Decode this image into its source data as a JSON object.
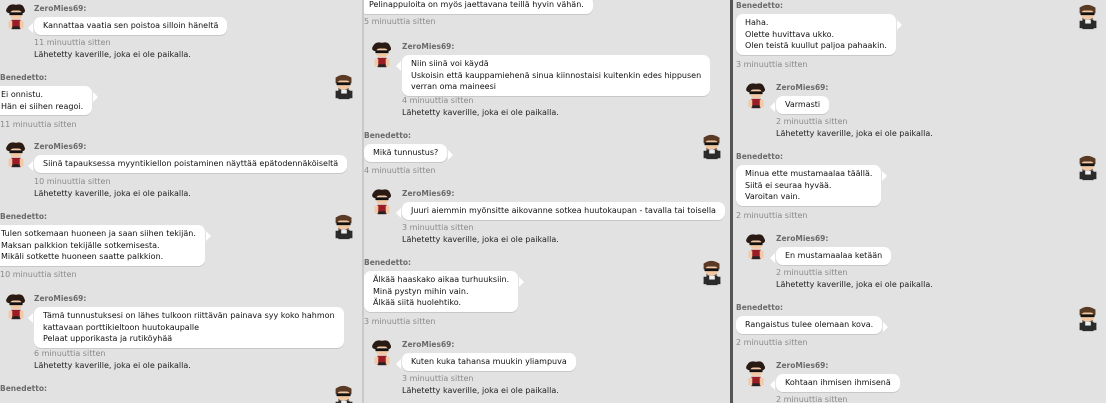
{
  "colors": {
    "background": "#e2e2e2",
    "bubble": "#ffffff",
    "name": "#6b6b6b",
    "time": "#8a8a8a"
  },
  "panel1": {
    "m1": {
      "author": "ZeroMies69:",
      "text": "Kannattaa vaatia sen poistoa silloin häneltä",
      "time": "11 minuuttia sitten",
      "note": "Lähetetty kaverille, joka ei ole paikalla."
    },
    "m2": {
      "author": "Benedetto:",
      "text": "Ei onnistu.\nHän ei siihen reagoi.",
      "time": "11 minuuttia sitten"
    },
    "m3": {
      "author": "ZeroMies69:",
      "text": "Siinä tapauksessa myyntikiellon poistaminen näyttää epätodennäköiseltä",
      "time": "10 minuuttia sitten",
      "note": "Lähetetty kaverille, joka ei ole paikalla."
    },
    "m4": {
      "author": "Benedetto:",
      "text": "Tulen sotkemaan huoneen ja saan siihen tekijän.\nMaksan palkkion tekijälle sotkemisesta.\nMikäli sotkette huoneen saatte palkkion.",
      "time": "10 minuuttia sitten"
    },
    "m5": {
      "author": "ZeroMies69:",
      "text": "Tämä tunnustuksesi on lähes tulkoon riittävän painava syy koko hahmon\nkattavaan porttikieltoon huutokaupalle\nPelaat upporikasta ja rutiköyhää",
      "time": "6 minuuttia sitten",
      "note": "Lähetetty kaverille, joka ei ole paikalla."
    },
    "m6": {
      "author": "Benedetto:"
    }
  },
  "panel2": {
    "m0": {
      "text": "Pelinappuloita on myös jaettavana teillä hyvin vähän.",
      "time": "5 minuuttia sitten"
    },
    "m1": {
      "author": "ZeroMies69:",
      "text": "Niin siinä voi käydä\nUskoisin että kauppamiehenä sinua kiinnostaisi kuitenkin edes hippusen\nverran oma maineesi",
      "time": "4 minuuttia sitten",
      "note": "Lähetetty kaverille, joka ei ole paikalla."
    },
    "m2": {
      "author": "Benedetto:",
      "text": "Mikä tunnustus?",
      "time": "4 minuuttia sitten"
    },
    "m3": {
      "author": "ZeroMies69:",
      "text": "Juuri aiemmin myönsitte aikovanne sotkea huutokaupan - tavalla tai toisella",
      "time": "3 minuuttia sitten",
      "note": "Lähetetty kaverille, joka ei ole paikalla."
    },
    "m4": {
      "author": "Benedetto:",
      "text": "Älkää haaskako aikaa turhuuksiin.\nMinä pystyn mihin vain.\nÄlkää siitä huolehtiko.",
      "time": "3 minuuttia sitten"
    },
    "m5": {
      "author": "ZeroMies69:",
      "text": "Kuten kuka tahansa muukin yliampuva",
      "time": "3 minuuttia sitten",
      "note": "Lähetetty kaverille, joka ei ole paikalla."
    }
  },
  "panel3": {
    "m1": {
      "author": "Benedetto:",
      "text": "Haha.\nOlette huvittava ukko.\nOlen teistä kuullut paljoa pahaakin.",
      "time": "3 minuuttia sitten"
    },
    "m2": {
      "author": "ZeroMies69:",
      "text": "Varmasti",
      "time": "2 minuuttia sitten",
      "note": "Lähetetty kaverille, joka ei ole paikalla."
    },
    "m3": {
      "author": "Benedetto:",
      "text": "Minua ette mustamaalaa täällä.\nSiitä ei seuraa hyvää.\nVaroitan vain.",
      "time": "2 minuuttia sitten"
    },
    "m4": {
      "author": "ZeroMies69:",
      "text": "En mustamaalaa ketään",
      "time": "2 minuuttia sitten",
      "note": "Lähetetty kaverille, joka ei ole paikalla."
    },
    "m5": {
      "author": "Benedetto:",
      "text": "Rangaistus tulee olemaan kova.",
      "time": "2 minuuttia sitten"
    },
    "m6": {
      "author": "ZeroMies69:",
      "text": "Kohtaan ihmisen ihmisenä",
      "time": "2 minuuttia sitten"
    }
  }
}
